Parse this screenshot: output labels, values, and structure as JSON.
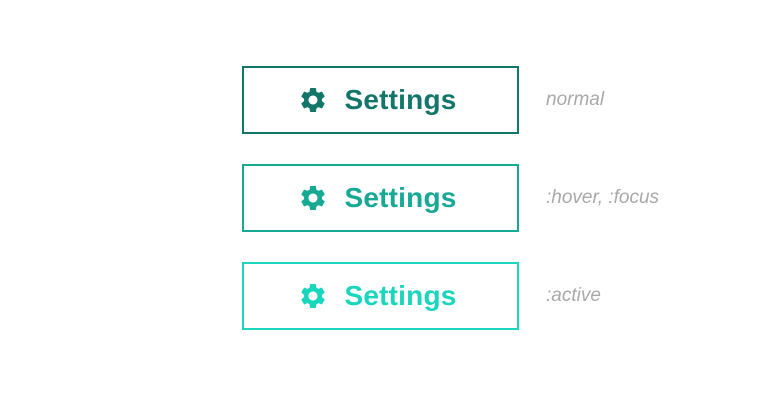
{
  "colors": {
    "normal": "#13766a",
    "hover_focus": "#16a994",
    "active": "#1ad6bc",
    "state_label": "#a9a9a9",
    "background": "#ffffff"
  },
  "buttons": [
    {
      "label": "Settings",
      "icon": "gear-icon",
      "state_label": "normal"
    },
    {
      "label": "Settings",
      "icon": "gear-icon",
      "state_label": ":hover, :focus"
    },
    {
      "label": "Settings",
      "icon": "gear-icon",
      "state_label": ":active"
    }
  ]
}
